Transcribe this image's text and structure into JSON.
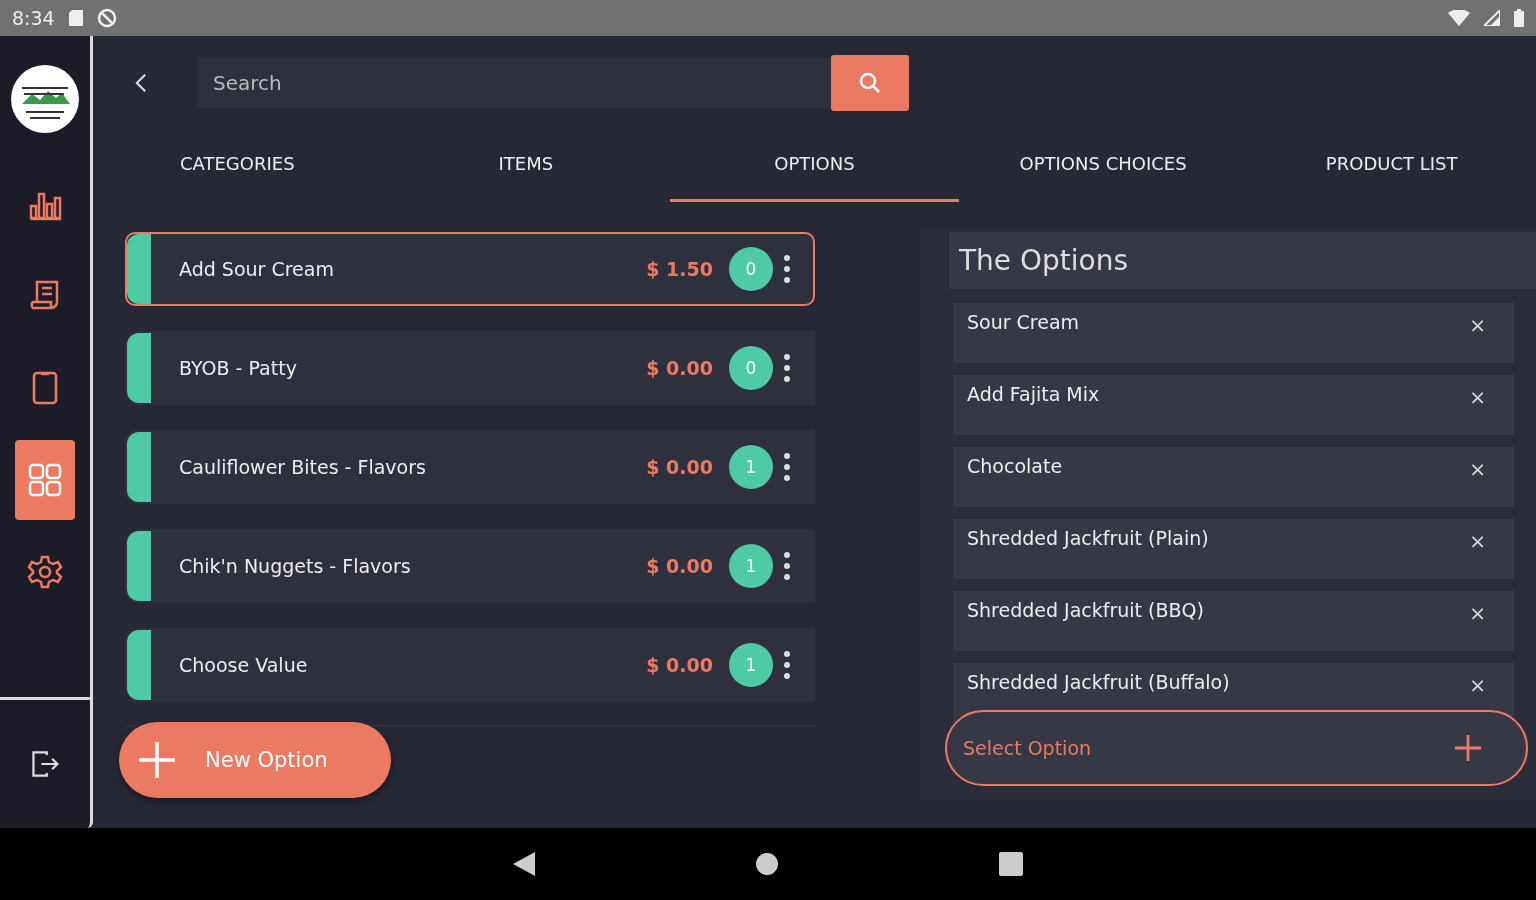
{
  "status_bar": {
    "time": "8:34"
  },
  "sidebar": {
    "items": [
      {
        "kind": "chart",
        "selected": false
      },
      {
        "kind": "receipt",
        "selected": false
      },
      {
        "kind": "tablet",
        "selected": false
      },
      {
        "kind": "grid",
        "selected": true
      },
      {
        "kind": "settings",
        "selected": false
      }
    ]
  },
  "search": {
    "placeholder": "Search"
  },
  "tabs": [
    {
      "label": "CATEGORIES",
      "selected": false
    },
    {
      "label": "ITEMS",
      "selected": false
    },
    {
      "label": "OPTIONS",
      "selected": true
    },
    {
      "label": "OPTIONS CHOICES",
      "selected": false
    },
    {
      "label": "PRODUCT LIST",
      "selected": false
    }
  ],
  "options": [
    {
      "name": "Add Sour Cream",
      "price": "$ 1.50",
      "count": "0",
      "selected": true
    },
    {
      "name": "BYOB - Patty",
      "price": "$ 0.00",
      "count": "0",
      "selected": false
    },
    {
      "name": "Cauliflower Bites - Flavors",
      "price": "$ 0.00",
      "count": "1",
      "selected": false
    },
    {
      "name": "Chik'n Nuggets - Flavors",
      "price": "$ 0.00",
      "count": "1",
      "selected": false
    },
    {
      "name": "Choose Value",
      "price": "$ 0.00",
      "count": "1",
      "selected": false
    }
  ],
  "new_option_button": "New Option",
  "choices_panel": {
    "title": "The Options",
    "items": [
      {
        "name": "Sour Cream",
        "remove": "×"
      },
      {
        "name": "Add Fajita Mix",
        "remove": "×"
      },
      {
        "name": "Chocolate",
        "remove": "×"
      },
      {
        "name": "Shredded Jackfruit (Plain)",
        "remove": "×"
      },
      {
        "name": "Shredded Jackfruit (BBQ)",
        "remove": "×"
      },
      {
        "name": "Shredded Jackfruit (Buffalo)",
        "remove": "×"
      }
    ],
    "select_placeholder": "Select Option"
  }
}
